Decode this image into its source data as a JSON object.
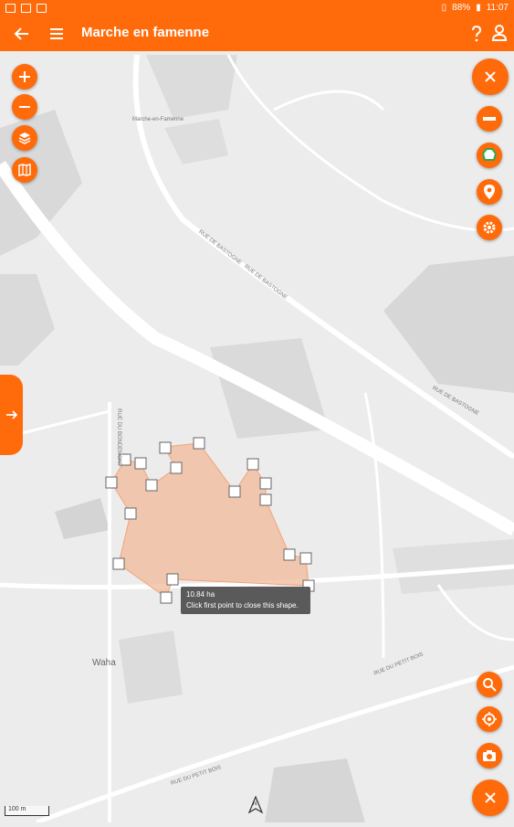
{
  "status": {
    "battery": "88%",
    "time": "11:07"
  },
  "appbar": {
    "title": "Marche en famenne"
  },
  "map": {
    "labels": {
      "town": "Marche-en-Famenne",
      "street1": "RUE DE BASTOGNE",
      "street2": "RUE DE BASTOGNE",
      "street3": "RUE DE BASTOGNE",
      "street4": "RUE DU BONDEMONT",
      "street5": "RUE DU PETIT BOIS",
      "street6": "RUE DU PETIT BOIS",
      "village": "Waha"
    },
    "tooltip": {
      "area": "10.84 ha",
      "hint": "Click first point to close this shape."
    },
    "scale": "100 m",
    "compass": "N"
  },
  "controls": {
    "left": [
      "zoom-in-icon",
      "zoom-out-icon",
      "layers-icon",
      "map-icon"
    ],
    "right": [
      "close-icon",
      "remove-icon",
      "polygon-icon",
      "marker-icon",
      "settings-icon"
    ],
    "bottom": [
      "search-icon",
      "locate-icon",
      "camera-icon",
      "close-icon"
    ]
  },
  "colors": {
    "accent": "#ff6b0a",
    "polygon_fill": "#f2b99a",
    "map_bg": "#ececec"
  }
}
